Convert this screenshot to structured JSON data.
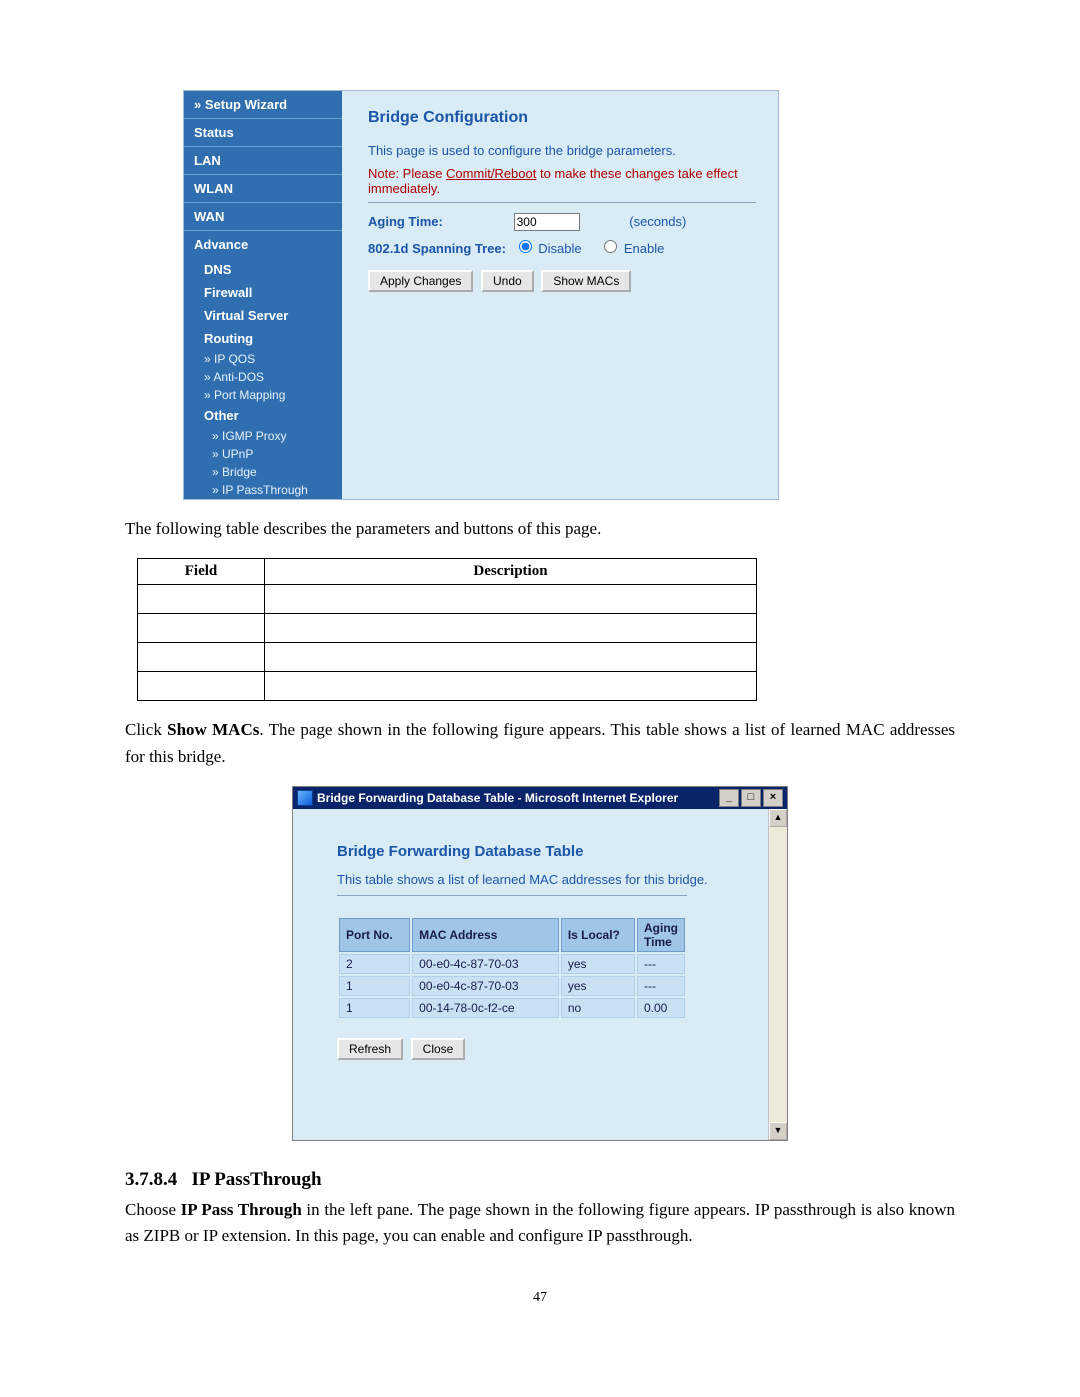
{
  "shot1": {
    "sidebar": {
      "setup": "Setup Wizard",
      "status": "Status",
      "lan": "LAN",
      "wlan": "WLAN",
      "wan": "WAN",
      "advance": "Advance",
      "dns": "DNS",
      "firewall": "Firewall",
      "vserver": "Virtual Server",
      "routing": "Routing",
      "ipqos": "IP QOS",
      "antidos": "Anti-DOS",
      "portmap": "Port Mapping",
      "other": "Other",
      "igmp": "IGMP Proxy",
      "upnp": "UPnP",
      "bridge": "Bridge",
      "ippass": "IP PassThrough"
    },
    "title": "Bridge Configuration",
    "intro": "This page is used to configure the bridge parameters.",
    "note_prefix": "Note: Please ",
    "note_link": "Commit/Reboot",
    "note_suffix": " to make these changes take effect immediately.",
    "aging_label": "Aging Time:",
    "aging_value": "300",
    "seconds": "(seconds)",
    "stp_label": "802.1d Spanning Tree:",
    "disable": "Disable",
    "enable": "Enable",
    "btn_apply": "Apply Changes",
    "btn_undo": "Undo",
    "btn_show": "Show MACs"
  },
  "body1": "The following table describes the parameters and buttons of this page.",
  "fdtable": {
    "h1": "Field",
    "h2": "Description"
  },
  "body2_a": "Click ",
  "body2_b": "Show MACs",
  "body2_c": ". The page shown in the following figure appears. This table shows a list of learned MAC addresses for this bridge.",
  "shot2": {
    "titlebar": "Bridge Forwarding Database Table - Microsoft Internet Explorer",
    "title": "Bridge Forwarding Database Table",
    "intro": "This table shows a list of learned MAC addresses for this bridge.",
    "headers": {
      "port": "Port No.",
      "mac": "MAC Address",
      "islocal": "Is Local?",
      "aging": "Aging Time"
    },
    "rows": [
      {
        "port": "2",
        "mac": "00-e0-4c-87-70-03",
        "islocal": "yes",
        "aging": "---"
      },
      {
        "port": "1",
        "mac": "00-e0-4c-87-70-03",
        "islocal": "yes",
        "aging": "---"
      },
      {
        "port": "1",
        "mac": "00-14-78-0c-f2-ce",
        "islocal": "no",
        "aging": "0.00"
      }
    ],
    "btn_refresh": "Refresh",
    "btn_close": "Close"
  },
  "heading_num": "3.7.8.4",
  "heading_txt": "IP PassThrough",
  "body3_a": "Choose ",
  "body3_b": "IP Pass Through",
  "body3_c": " in the left pane. The page shown in the following figure appears. IP passthrough is also known as ZIPB or IP extension. In this page, you can enable and configure IP passthrough.",
  "page_number": "47"
}
